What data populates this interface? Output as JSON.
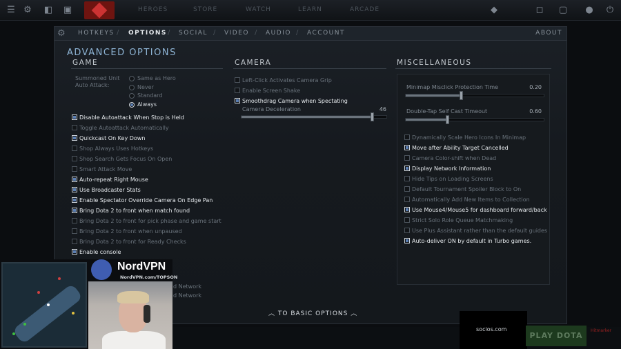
{
  "topbar": {
    "nav": [
      "HEROES",
      "STORE",
      "WATCH",
      "LEARN",
      "ARCADE"
    ]
  },
  "tabs": {
    "hotkeys": "HOTKEYS",
    "options": "OPTIONS",
    "social": "SOCIAL",
    "video": "VIDEO",
    "audio": "AUDIO",
    "account": "ACCOUNT",
    "about": "ABOUT",
    "separator": "/"
  },
  "title": "ADVANCED OPTIONS",
  "game": {
    "heading": "GAME",
    "summon_label": "Summoned Unit Auto Attack:",
    "radio": [
      {
        "label": "Same as Hero",
        "on": false
      },
      {
        "label": "Never",
        "on": false
      },
      {
        "label": "Standard",
        "on": false
      },
      {
        "label": "Always",
        "on": true
      }
    ],
    "items": [
      {
        "label": "Disable Autoattack When Stop is Held",
        "on": true
      },
      {
        "label": "Toggle Autoattack Automatically",
        "on": false
      },
      {
        "label": "Quickcast On Key Down",
        "on": true
      },
      {
        "label": "Shop Always Uses Hotkeys",
        "on": false
      },
      {
        "label": "Shop Search Gets Focus On Open",
        "on": false
      },
      {
        "label": "Smart Attack Move",
        "on": false
      },
      {
        "label": "Auto-repeat Right Mouse",
        "on": true
      },
      {
        "label": "Use Broadcaster Stats",
        "on": true
      },
      {
        "label": "Enable Spectator Override Camera On Edge Pan",
        "on": true
      },
      {
        "label": "Bring Dota 2 to front when match found",
        "on": true
      },
      {
        "label": "Bring Dota 2 to front for pick phase and game start",
        "on": false
      },
      {
        "label": "Bring Dota 2 to front when unpaused",
        "on": false
      },
      {
        "label": "Bring Dota 2 to front for Ready Checks",
        "on": false
      },
      {
        "label": "Enable console",
        "on": true
      }
    ],
    "network_partial": [
      "d Network",
      "d Network"
    ],
    "network_head_partial": "WORK"
  },
  "camera": {
    "heading": "CAMERA",
    "items": [
      {
        "label": "Left-Click Activates Camera Grip",
        "on": false
      },
      {
        "label": "Enable Screen Shake",
        "on": false
      },
      {
        "label": "Smoothdrag Camera when Spectating",
        "on": true
      }
    ],
    "decel_label": "Camera Deceleration",
    "decel_value": "46",
    "decel_fraction": 0.9
  },
  "misc": {
    "heading": "MISCELLANEOUS",
    "slider1_label": "Minimap Misclick Protection Time",
    "slider1_value": "0.20",
    "slider1_fraction": 0.4,
    "slider2_label": "Double-Tap Self Cast Timeout",
    "slider2_value": "0.60",
    "slider2_fraction": 0.3,
    "items": [
      {
        "label": "Dynamically Scale Hero Icons In Minimap",
        "on": false
      },
      {
        "label": "Move after Ability Target Cancelled",
        "on": true
      },
      {
        "label": "Camera Color-shift when Dead",
        "on": false
      },
      {
        "label": "Display Network Information",
        "on": true
      },
      {
        "label": "Hide Tips on Loading Screens",
        "on": false
      },
      {
        "label": "Default Tournament Spoiler Block to On",
        "on": false
      },
      {
        "label": "Automatically Add New Items to Collection",
        "on": false
      },
      {
        "label": "Use Mouse4/Mouse5 for dashboard forward/back",
        "on": true
      },
      {
        "label": "Strict Solo Role Queue Matchmaking",
        "on": false
      },
      {
        "label": "Use Plus Assistant rather than the default guides",
        "on": false
      },
      {
        "label": "Auto-deliver ON by default in Turbo games.",
        "on": true
      }
    ]
  },
  "basic_button": "TO BASIC OPTIONS",
  "overlay": {
    "nord_brand": "NordVPN",
    "nord_url": "NordVPN.com/TOPSON",
    "socios": "socios.com",
    "play": "PLAY DOTA",
    "watermark": "Hitmarker"
  }
}
